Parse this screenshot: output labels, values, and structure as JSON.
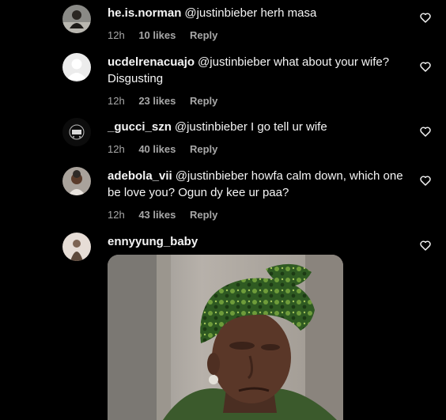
{
  "comments": [
    {
      "username": "he.is.norman",
      "text": "@justinbieber herh masa",
      "time": "12h",
      "likes": "10 likes",
      "reply": "Reply",
      "avatar": "photo-person-sitting"
    },
    {
      "username": "ucdelrenacuajo",
      "text": "@justinbieber what about your wife? Disgusting",
      "time": "12h",
      "likes": "23 likes",
      "reply": "Reply",
      "avatar": "default-user-icon"
    },
    {
      "username": "_gucci_szn",
      "text": "@justinbieber I go tell ur wife",
      "time": "12h",
      "likes": "40 likes",
      "reply": "Reply",
      "avatar": "dark-logo-photo"
    },
    {
      "username": "adebola_vii",
      "text": "@justinbieber howfa calm down, which one be love you? Ogun dy kee ur paa?",
      "time": "12h",
      "likes": "43 likes",
      "reply": "Reply",
      "avatar": "photo-person-portrait"
    },
    {
      "username": "ennyyung_baby",
      "text": "",
      "avatar": "photo-person-light",
      "attachment": "gif-woman-green-headwrap"
    }
  ],
  "icons": {
    "like": "heart-outline-icon"
  },
  "colors": {
    "background": "#000000",
    "primary_text": "#f5f5f5",
    "secondary_text": "#a8a8a8"
  }
}
